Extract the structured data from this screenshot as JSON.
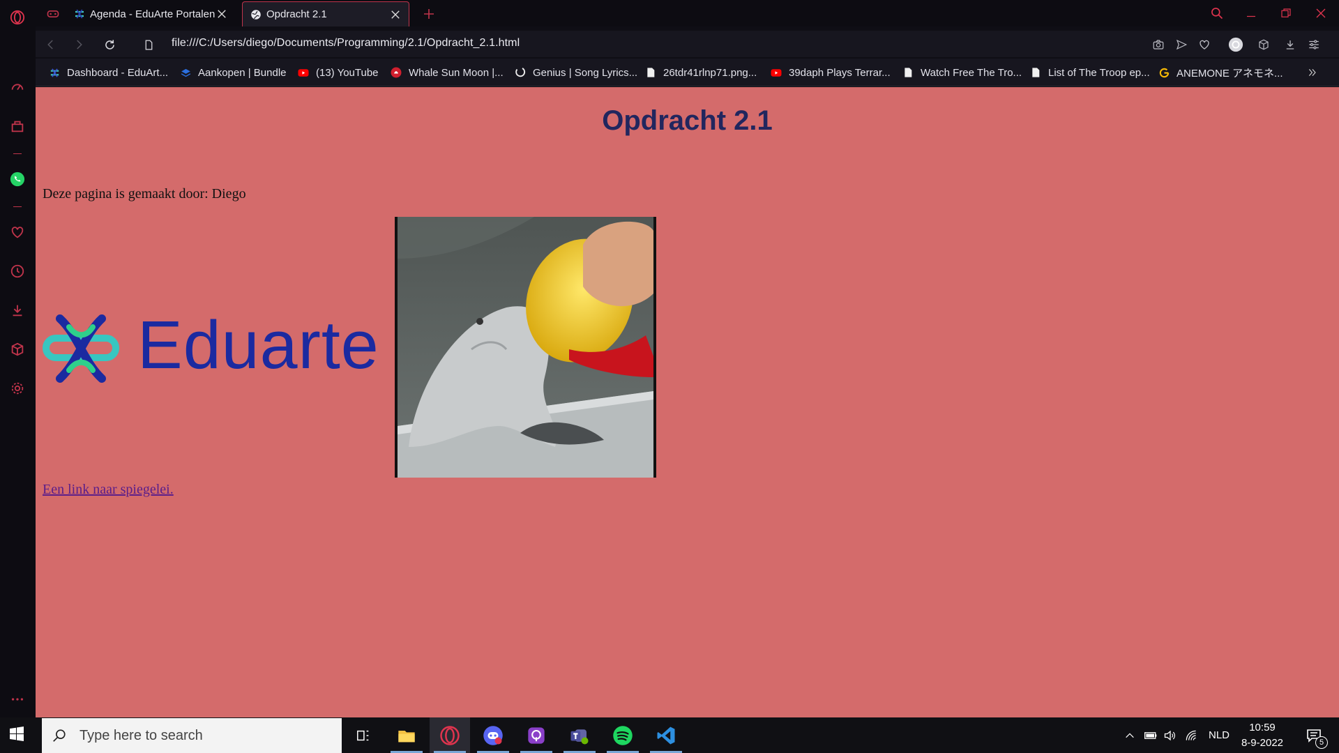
{
  "browser": {
    "tabs": [
      {
        "label": "Agenda - EduArte Portalen"
      },
      {
        "label": "Opdracht 2.1"
      }
    ],
    "url": "file:///C:/Users/diego/Documents/Programming/2.1/Opdracht_2.1.html",
    "bookmarks": [
      {
        "label": "Dashboard - EduArt...",
        "icon": "eduarte-icon"
      },
      {
        "label": "Aankopen | Bundle",
        "icon": "bundle-icon"
      },
      {
        "label": "(13) YouTube",
        "icon": "youtube-icon"
      },
      {
        "label": "Whale Sun Moon |...",
        "icon": "whale-icon"
      },
      {
        "label": "Genius | Song Lyrics...",
        "icon": "genius-icon"
      },
      {
        "label": "26tdr41rlnp71.png...",
        "icon": "file-icon"
      },
      {
        "label": "39daph Plays Terrar...",
        "icon": "youtube-icon"
      },
      {
        "label": "Watch Free The Tro...",
        "icon": "file-icon"
      },
      {
        "label": "List of The Troop ep...",
        "icon": "file-icon"
      },
      {
        "label": "ANEMONE アネモネ...",
        "icon": "google-icon"
      }
    ],
    "accent": "#c0344b"
  },
  "page": {
    "title": "Opdracht 2.1",
    "byline": "Deze pagina is gemaakt door: Diego",
    "logo_text": "Eduarte",
    "link_text": "Een link naar spiegelei.",
    "background": "#d46b6b"
  },
  "taskbar": {
    "search_placeholder": "Type here to search",
    "language": "NLD",
    "time": "10:59",
    "date": "8-9-2022",
    "notification_count": "5"
  }
}
